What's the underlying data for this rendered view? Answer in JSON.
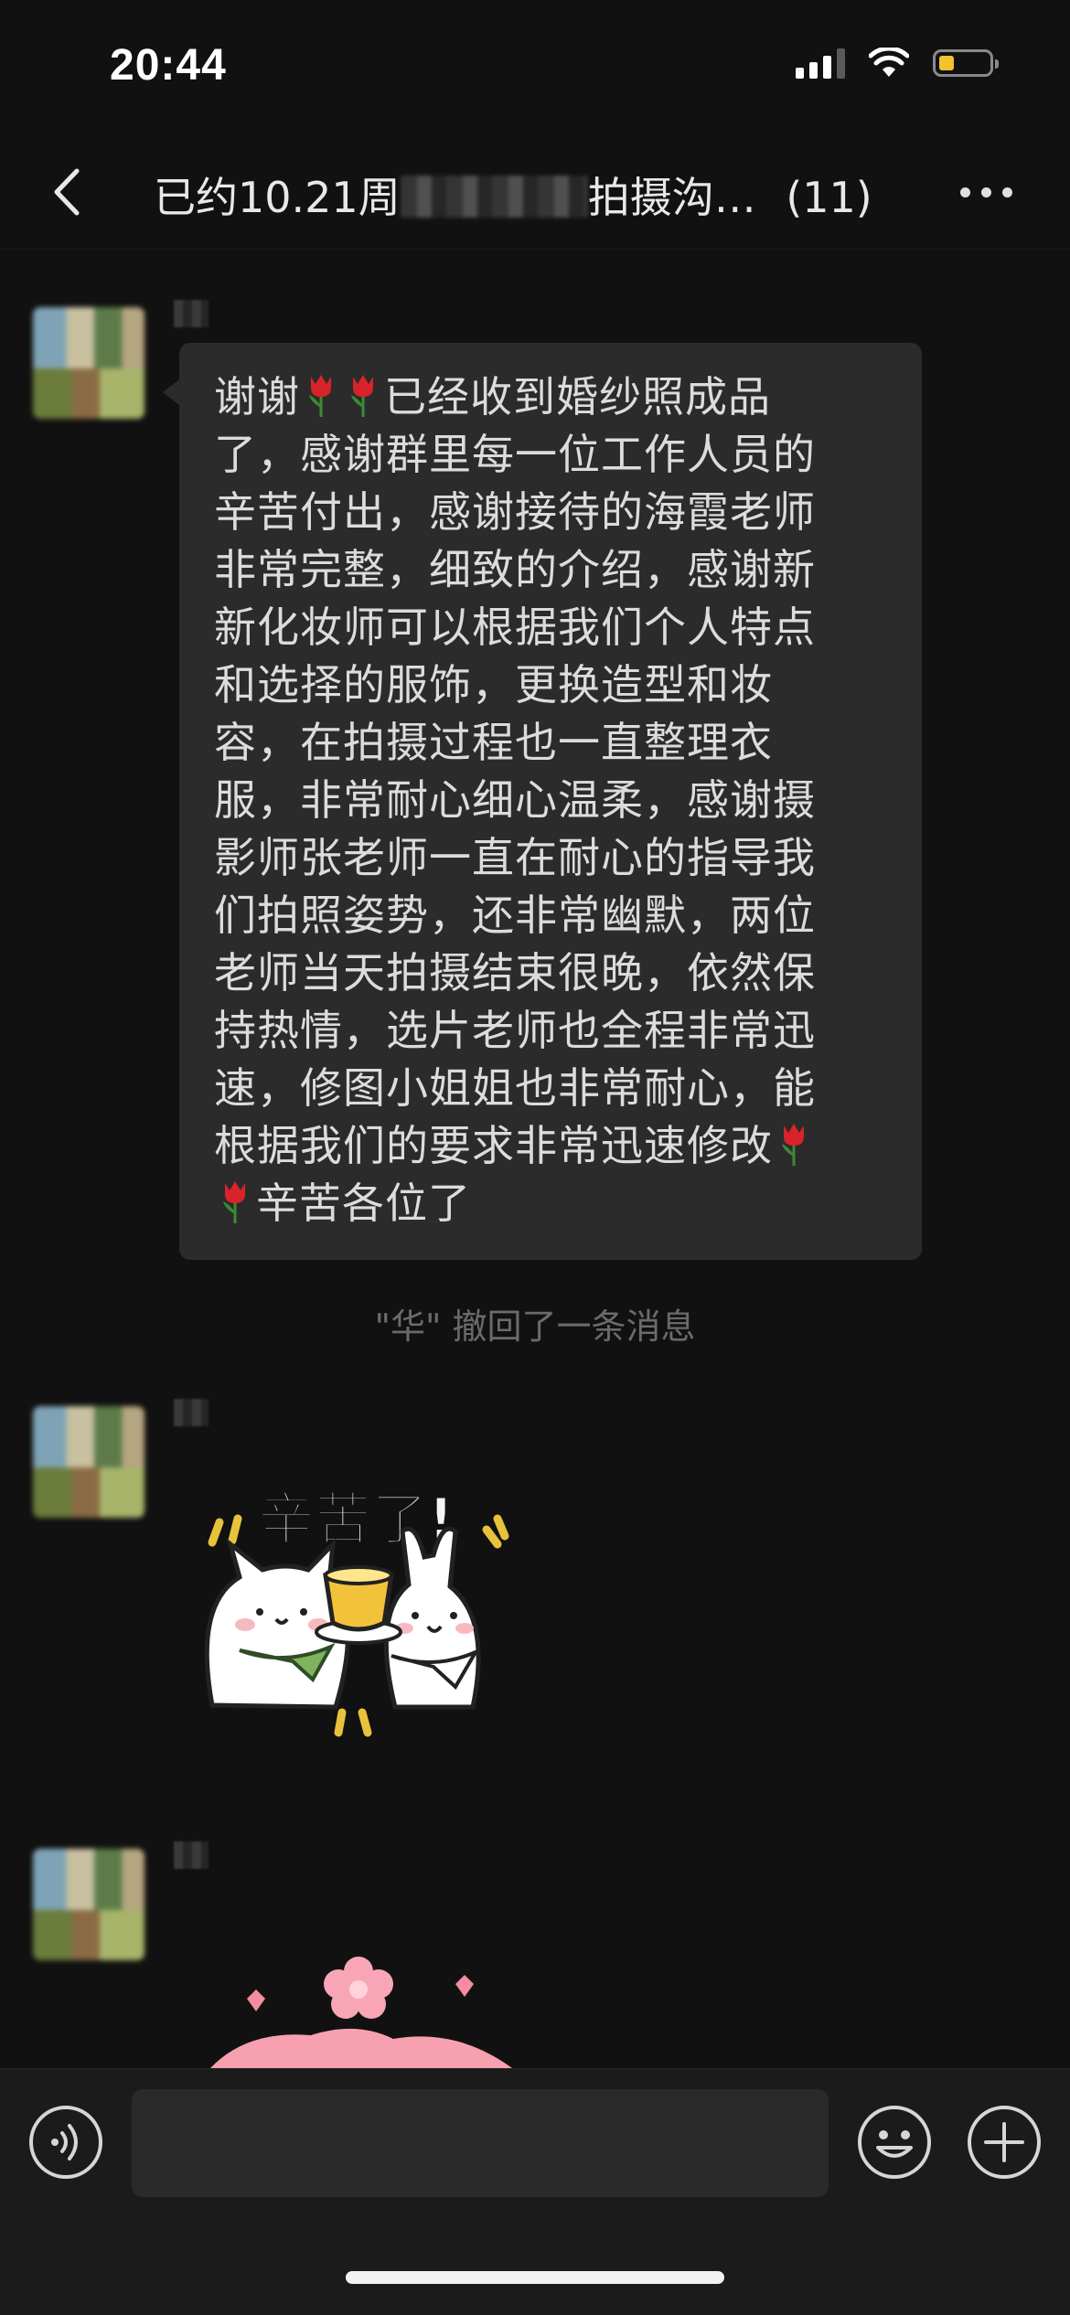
{
  "status_bar": {
    "time": "20:44",
    "battery_color": "#f2c12e"
  },
  "nav": {
    "title_prefix": "已约10.21周",
    "title_suffix": "拍摄沟…",
    "member_count": "(11)",
    "icons": [
      "chevron-left-icon",
      "more-dots-icon"
    ]
  },
  "messages": [
    {
      "type": "text",
      "lines": [
        "谢谢",
        "已经收到婚纱照成品",
        "了，感谢群里每一位工作人员的",
        "辛苦付出，感谢接待的海霞老师",
        "非常完整，细致的介绍，感谢新",
        "新化妆师可以根据我们个人特点",
        "和选择的服饰，更换造型和妆",
        "容，在拍摄过程也一直整理衣",
        "服，非常耐心细心温柔，感谢摄",
        "影师张老师一直在耐心的指导我",
        "们拍照姿势，还非常幽默，两位",
        "老师当天拍摄结束很晚，依然保",
        "持热情，选片老师也全程非常迅",
        "速，修图小姐姐也非常耐心，能",
        "根据我们的要求非常迅速修改",
        "辛苦各位了"
      ],
      "emoji": "tulip"
    },
    {
      "type": "system",
      "text": "\"华\" 撤回了一条消息"
    },
    {
      "type": "sticker",
      "sticker_text": "辛苦了!",
      "sticker": "cat-and-bunny-toasting-tea"
    },
    {
      "type": "sticker",
      "sticker": "pink-flowers-cropped"
    }
  ],
  "input_bar": {
    "placeholder": "",
    "icons": [
      "voice-icon",
      "emoji-icon",
      "plus-icon"
    ]
  },
  "colors": {
    "background": "#111111",
    "bubble": "#2b2b2b",
    "input_bar": "#1b1b1b"
  }
}
